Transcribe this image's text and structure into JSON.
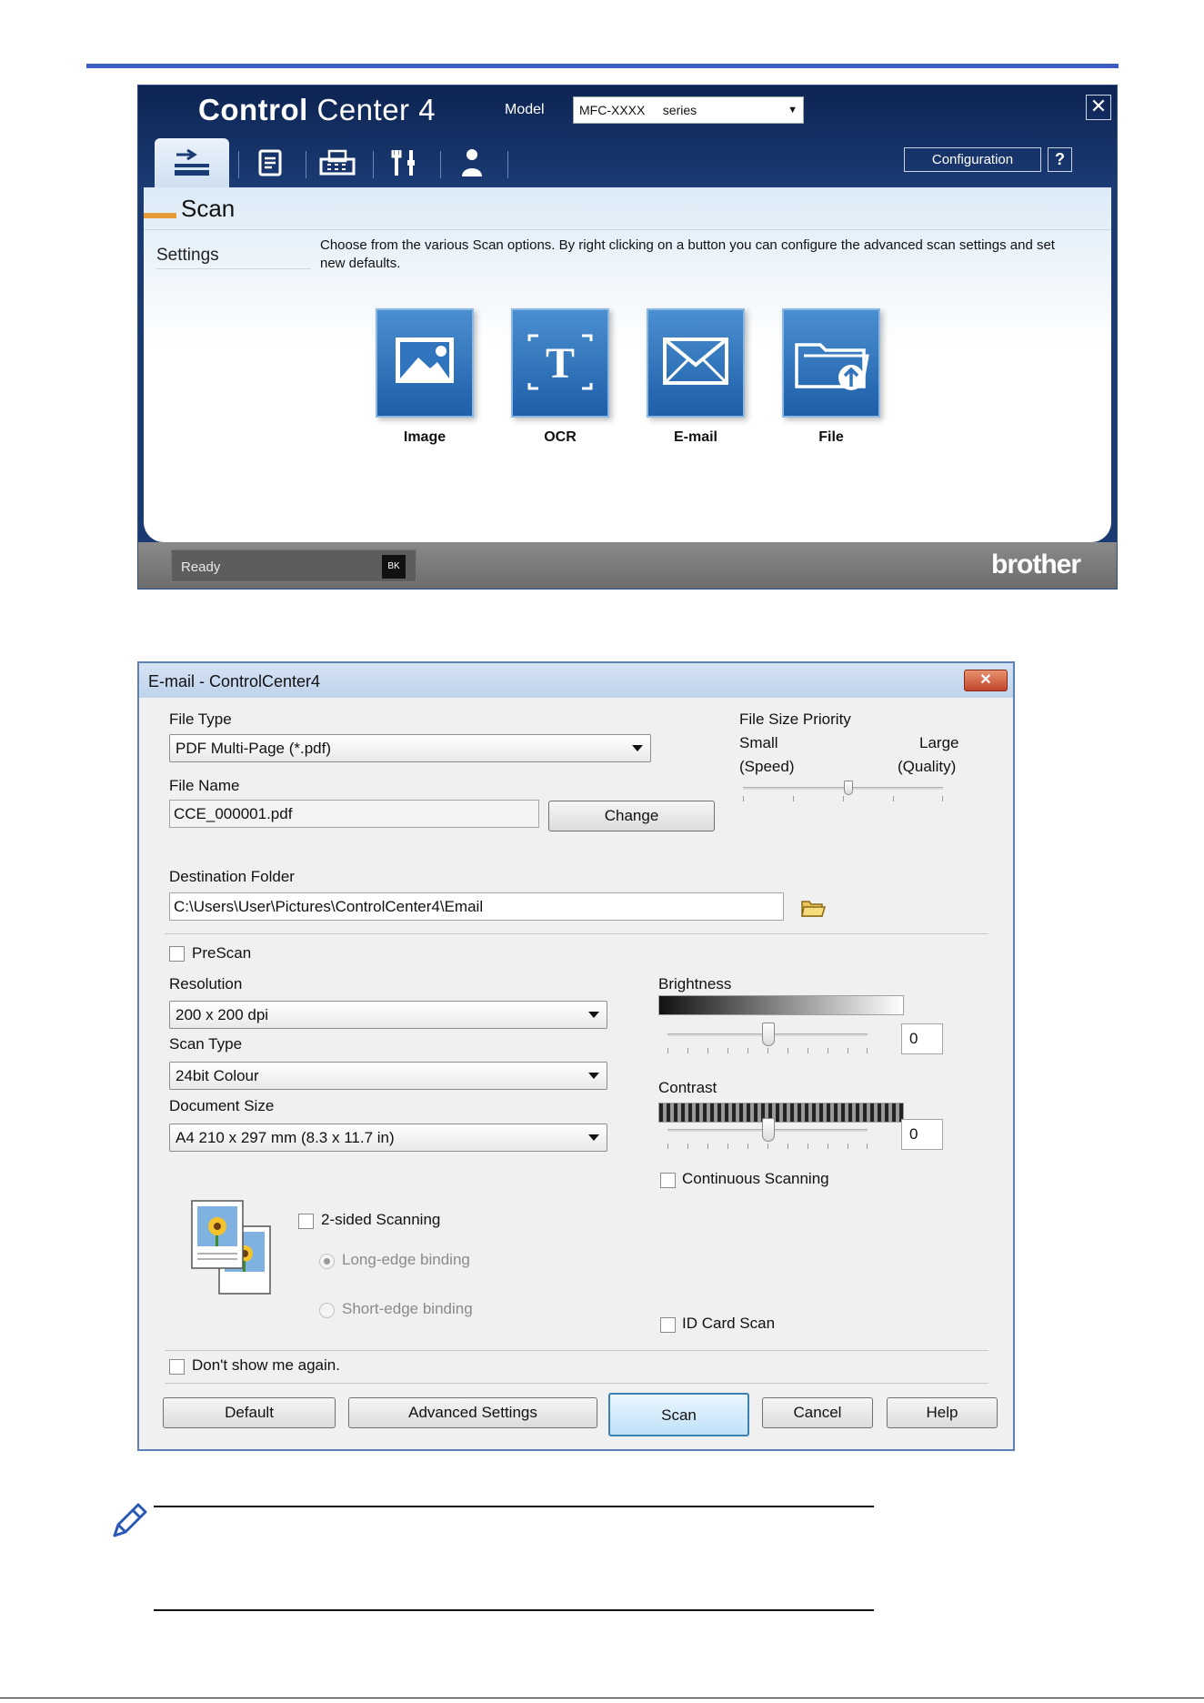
{
  "control_center": {
    "logo_bold": "Control",
    "logo_rest": "Center 4",
    "model_label": "Model",
    "model_value": "MFC-XXXX     series",
    "close_glyph": "✕",
    "tabs": [
      {
        "icon": "scan-icon"
      },
      {
        "icon": "pc-fax-document-icon"
      },
      {
        "icon": "fax-icon"
      },
      {
        "icon": "device-settings-icon"
      },
      {
        "icon": "support-person-icon"
      }
    ],
    "configuration_label": "Configuration",
    "help_label": "?",
    "scan_title": "Scan",
    "settings_label": "Settings",
    "description": "Choose from the various Scan options. By right clicking on a button you can configure the advanced scan settings and set new defaults.",
    "tiles": [
      {
        "label": "Image",
        "icon": "image-icon"
      },
      {
        "label": "OCR",
        "icon": "ocr-text-icon"
      },
      {
        "label": "E-mail",
        "icon": "envelope-icon"
      },
      {
        "label": "File",
        "icon": "folder-upload-icon"
      }
    ],
    "status_text": "Ready",
    "ink_badge": "BK",
    "brand": "brother",
    "colors": {
      "accent": "#e79b3b",
      "header": "#1b3b74",
      "tile": "#2f74bd"
    }
  },
  "email_dialog": {
    "title": "E-mail - ControlCenter4",
    "close_glyph": "✕",
    "file_type_label": "File Type",
    "file_type_value": "PDF Multi-Page (*.pdf)",
    "file_size_priority_label": "File Size Priority",
    "small_label": "Small",
    "small_sub": "(Speed)",
    "large_label": "Large",
    "large_sub": "(Quality)",
    "file_name_label": "File Name",
    "file_name_value": "CCE_000001.pdf",
    "change_button": "Change",
    "destination_folder_label": "Destination Folder",
    "destination_folder_value": "C:\\Users\\User\\Pictures\\ControlCenter4\\Email",
    "prescan_label": "PreScan",
    "resolution_label": "Resolution",
    "resolution_value": "200 x 200 dpi",
    "scan_type_label": "Scan Type",
    "scan_type_value": "24bit Colour",
    "document_size_label": "Document Size",
    "document_size_value": "A4 210 x 297 mm (8.3 x 11.7 in)",
    "brightness_label": "Brightness",
    "brightness_value": "0",
    "contrast_label": "Contrast",
    "contrast_value": "0",
    "continuous_scanning_label": "Continuous Scanning",
    "two_sided_label": "2-sided Scanning",
    "long_edge_label": "Long-edge binding",
    "short_edge_label": "Short-edge binding",
    "id_card_label": "ID Card Scan",
    "dont_show_label": "Don't show me again.",
    "buttons": {
      "default": "Default",
      "advanced": "Advanced Settings",
      "scan": "Scan",
      "cancel": "Cancel",
      "help": "Help"
    }
  }
}
